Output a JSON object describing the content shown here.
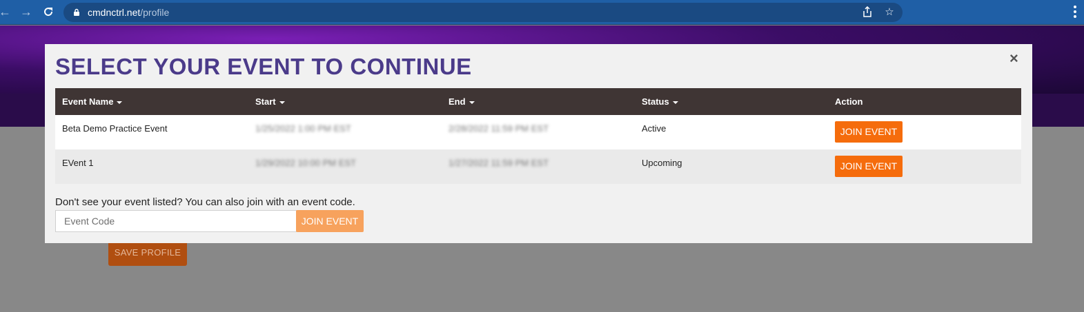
{
  "browser": {
    "url_host": "cmdnctrl.net",
    "url_path": "/profile",
    "icons": [
      "back-arrow-icon",
      "forward-arrow-icon",
      "reload-icon",
      "lock-icon",
      "share-icon",
      "star-icon",
      "menu-icon"
    ]
  },
  "page": {
    "save_profile_label": "SAVE PROFILE"
  },
  "modal": {
    "title": "SELECT YOUR EVENT TO CONTINUE",
    "close_label": "×",
    "columns": {
      "name": "Event Name",
      "start": "Start",
      "end": "End",
      "status": "Status",
      "action": "Action"
    },
    "rows": [
      {
        "name": "Beta Demo Practice Event",
        "start": "1/25/2022 1:00 PM EST",
        "end": "2/28/2022 11:59 PM EST",
        "status": "Active",
        "action": "JOIN EVENT"
      },
      {
        "name": "EVent 1",
        "start": "1/29/2022 10:00 PM EST",
        "end": "1/27/2022 11:59 PM EST",
        "status": "Upcoming",
        "action": "JOIN EVENT"
      }
    ],
    "code_prompt": "Don't see your event listed? You can also join with an event code.",
    "code_placeholder": "Event Code",
    "code_button": "JOIN EVENT"
  },
  "colors": {
    "title": "#4b3b8a",
    "table_header": "#3f3534",
    "join_button": "#f56c0c",
    "join_button_disabled": "#f7a25d",
    "status_active": "#2fa34a",
    "status_upcoming": "#f2b01e"
  }
}
